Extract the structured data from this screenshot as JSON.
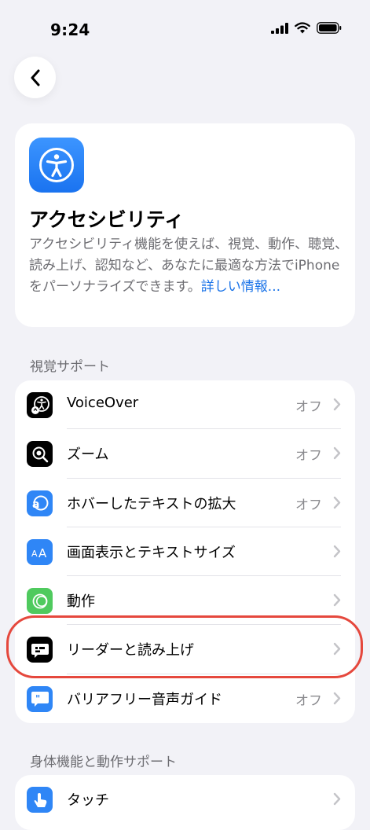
{
  "status": {
    "time": "9:24"
  },
  "header": {
    "title": "アクセシビリティ",
    "description": "アクセシビリティ機能を使えば、視覚、動作、聴覚、読み上げ、認知など、あなたに最適な方法でiPhoneをパーソナライズできます。",
    "learn_more": "詳しい情報..."
  },
  "vision": {
    "title": "視覚サポート",
    "items": [
      {
        "label": "VoiceOver",
        "value": "オフ",
        "icon": "voiceover-icon"
      },
      {
        "label": "ズーム",
        "value": "オフ",
        "icon": "zoom-icon"
      },
      {
        "label": "ホバーしたテキストの拡大",
        "value": "オフ",
        "icon": "hover-text-icon"
      },
      {
        "label": "画面表示とテキストサイズ",
        "value": "",
        "icon": "text-size-icon"
      },
      {
        "label": "動作",
        "value": "",
        "icon": "motion-icon"
      },
      {
        "label": "リーダーと読み上げ",
        "value": "",
        "icon": "reader-icon"
      },
      {
        "label": "バリアフリー音声ガイド",
        "value": "オフ",
        "icon": "audio-description-icon"
      }
    ]
  },
  "physical": {
    "title": "身体機能と動作サポート",
    "items": [
      {
        "label": "タッチ",
        "value": "",
        "icon": "touch-icon"
      }
    ]
  },
  "colors": {
    "accent": "#1a73e8",
    "highlight": "#e5483d"
  }
}
